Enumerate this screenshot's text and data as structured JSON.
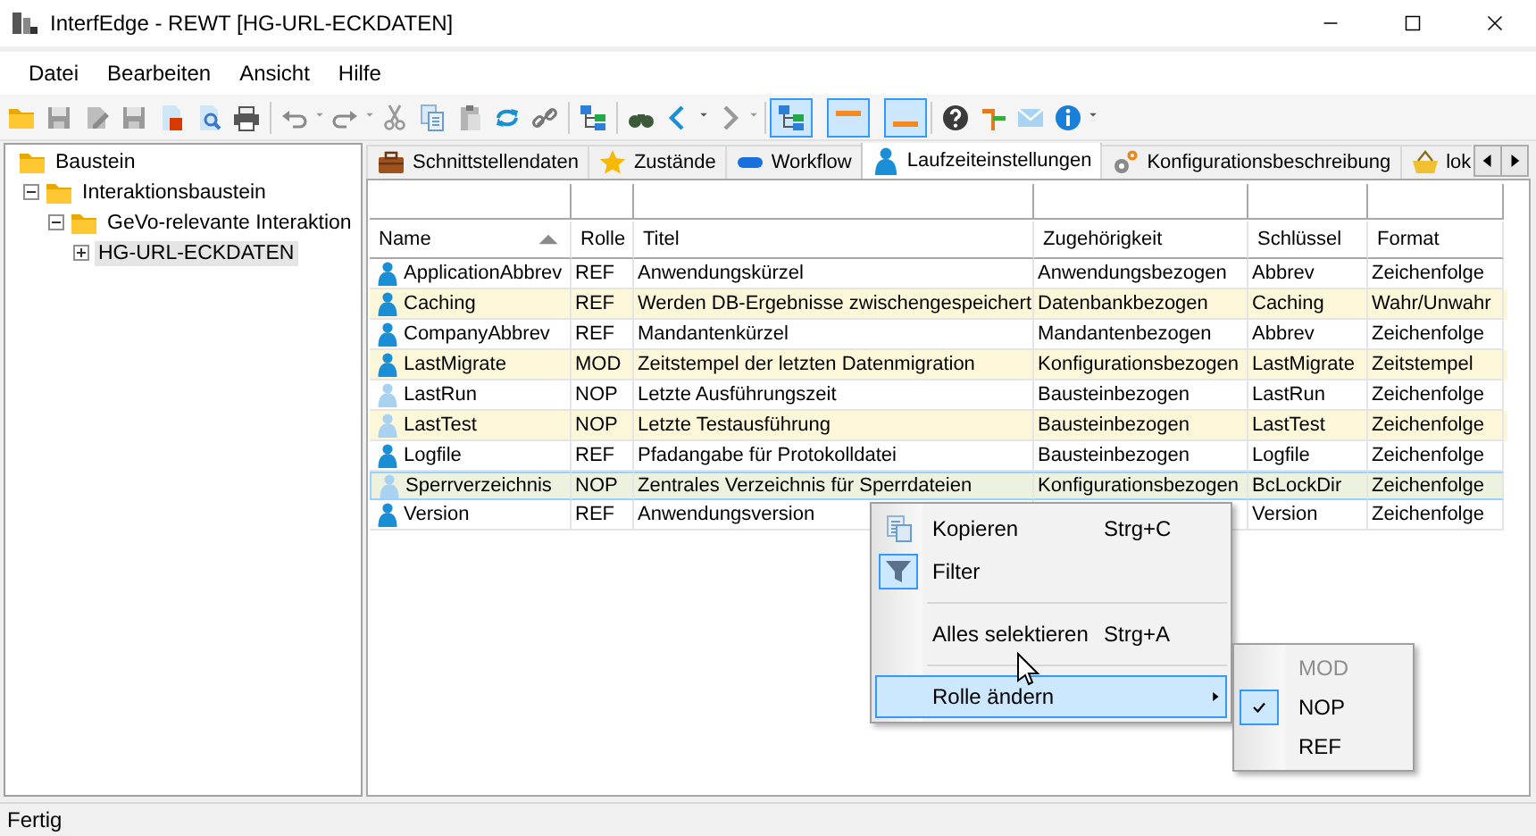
{
  "window": {
    "title": "InterfEdge - REWT [HG-URL-ECKDATEN]"
  },
  "menu": [
    "Datei",
    "Bearbeiten",
    "Ansicht",
    "Hilfe"
  ],
  "toolbar": {
    "view_toggles": [
      {
        "selected": true
      },
      {
        "selected": true
      },
      {
        "selected": true
      }
    ]
  },
  "tree": [
    {
      "label": "Baustein",
      "selected": false,
      "children": [
        {
          "label": "Interaktionsbaustein",
          "expanded": true,
          "selected": false,
          "children": [
            {
              "label": "GeVo-relevante Interaktion",
              "expanded": true,
              "selected": false,
              "children": [
                {
                  "label": "HG-URL-ECKDATEN",
                  "expanded": false,
                  "selected": true
                }
              ]
            }
          ]
        }
      ]
    }
  ],
  "tabs": [
    {
      "label": "Schnittstellendaten",
      "selected": false
    },
    {
      "label": "Zustände",
      "selected": false
    },
    {
      "label": "Workflow",
      "selected": false
    },
    {
      "label": "Laufzeiteinstellungen",
      "selected": true
    },
    {
      "label": "Konfigurationsbeschreibung",
      "selected": false
    },
    {
      "label": "lok",
      "selected": false
    }
  ],
  "table": {
    "columns": [
      {
        "label": "Name",
        "sorted": true
      },
      {
        "label": "Rolle",
        "sorted": false
      },
      {
        "label": "Titel",
        "sorted": false
      },
      {
        "label": "Zugehörigkeit",
        "sorted": false
      },
      {
        "label": "Schlüssel",
        "sorted": false
      },
      {
        "label": "Format",
        "sorted": false
      }
    ],
    "rows": [
      {
        "name": "ApplicationAbbrev",
        "role": "REF",
        "title": "Anwendungskürzel",
        "group": "Anwendungsbezogen",
        "key": "Abbrev",
        "format": "Zeichenfolge",
        "inactive": false,
        "selected": false
      },
      {
        "name": "Caching",
        "role": "REF",
        "title": "Werden DB-Ergebnisse zwischengespeichert",
        "group": "Datenbankbezogen",
        "key": "Caching",
        "format": "Wahr/Unwahr",
        "inactive": false,
        "selected": false
      },
      {
        "name": "CompanyAbbrev",
        "role": "REF",
        "title": "Mandantenkürzel",
        "group": "Mandantenbezogen",
        "key": "Abbrev",
        "format": "Zeichenfolge",
        "inactive": false,
        "selected": false
      },
      {
        "name": "LastMigrate",
        "role": "MOD",
        "title": "Zeitstempel der letzten Datenmigration",
        "group": "Konfigurationsbezogen",
        "key": "LastMigrate",
        "format": "Zeitstempel",
        "inactive": false,
        "selected": false
      },
      {
        "name": "LastRun",
        "role": "NOP",
        "title": "Letzte Ausführungszeit",
        "group": "Bausteinbezogen",
        "key": "LastRun",
        "format": "Zeichenfolge",
        "inactive": true,
        "selected": false
      },
      {
        "name": "LastTest",
        "role": "NOP",
        "title": "Letzte Testausführung",
        "group": "Bausteinbezogen",
        "key": "LastTest",
        "format": "Zeichenfolge",
        "inactive": true,
        "selected": false
      },
      {
        "name": "Logfile",
        "role": "REF",
        "title": "Pfadangabe für Protokolldatei",
        "group": "Bausteinbezogen",
        "key": "Logfile",
        "format": "Zeichenfolge",
        "inactive": false,
        "selected": false
      },
      {
        "name": "Sperrverzeichnis",
        "role": "NOP",
        "title": "Zentrales Verzeichnis für Sperrdateien",
        "group": "Konfigurationsbezogen",
        "key": "BcLockDir",
        "format": "Zeichenfolge",
        "inactive": true,
        "selected": true
      },
      {
        "name": "Version",
        "role": "REF",
        "title": "Anwendungsversion",
        "key": "Version",
        "format": "Zeichenfolge",
        "inactive": false,
        "selected": false
      }
    ]
  },
  "context_menu": {
    "items": [
      {
        "kind": "item",
        "label": "Kopieren",
        "shortcut": "Strg+C",
        "checked": false,
        "highlighted": false
      },
      {
        "kind": "item",
        "label": "Filter",
        "checked": true,
        "highlighted": false
      },
      {
        "kind": "separator"
      },
      {
        "kind": "item",
        "label": "Alles selektieren",
        "shortcut": "Strg+A",
        "checked": false,
        "highlighted": false
      },
      {
        "kind": "separator"
      },
      {
        "kind": "submenu",
        "label": "Rolle ändern",
        "highlighted": true
      }
    ],
    "submenu": [
      {
        "label": "MOD",
        "disabled": true,
        "checked": false
      },
      {
        "label": "NOP",
        "disabled": false,
        "checked": true
      },
      {
        "label": "REF",
        "disabled": false,
        "checked": false
      }
    ]
  },
  "status_bar": {
    "text": "Fertig"
  }
}
